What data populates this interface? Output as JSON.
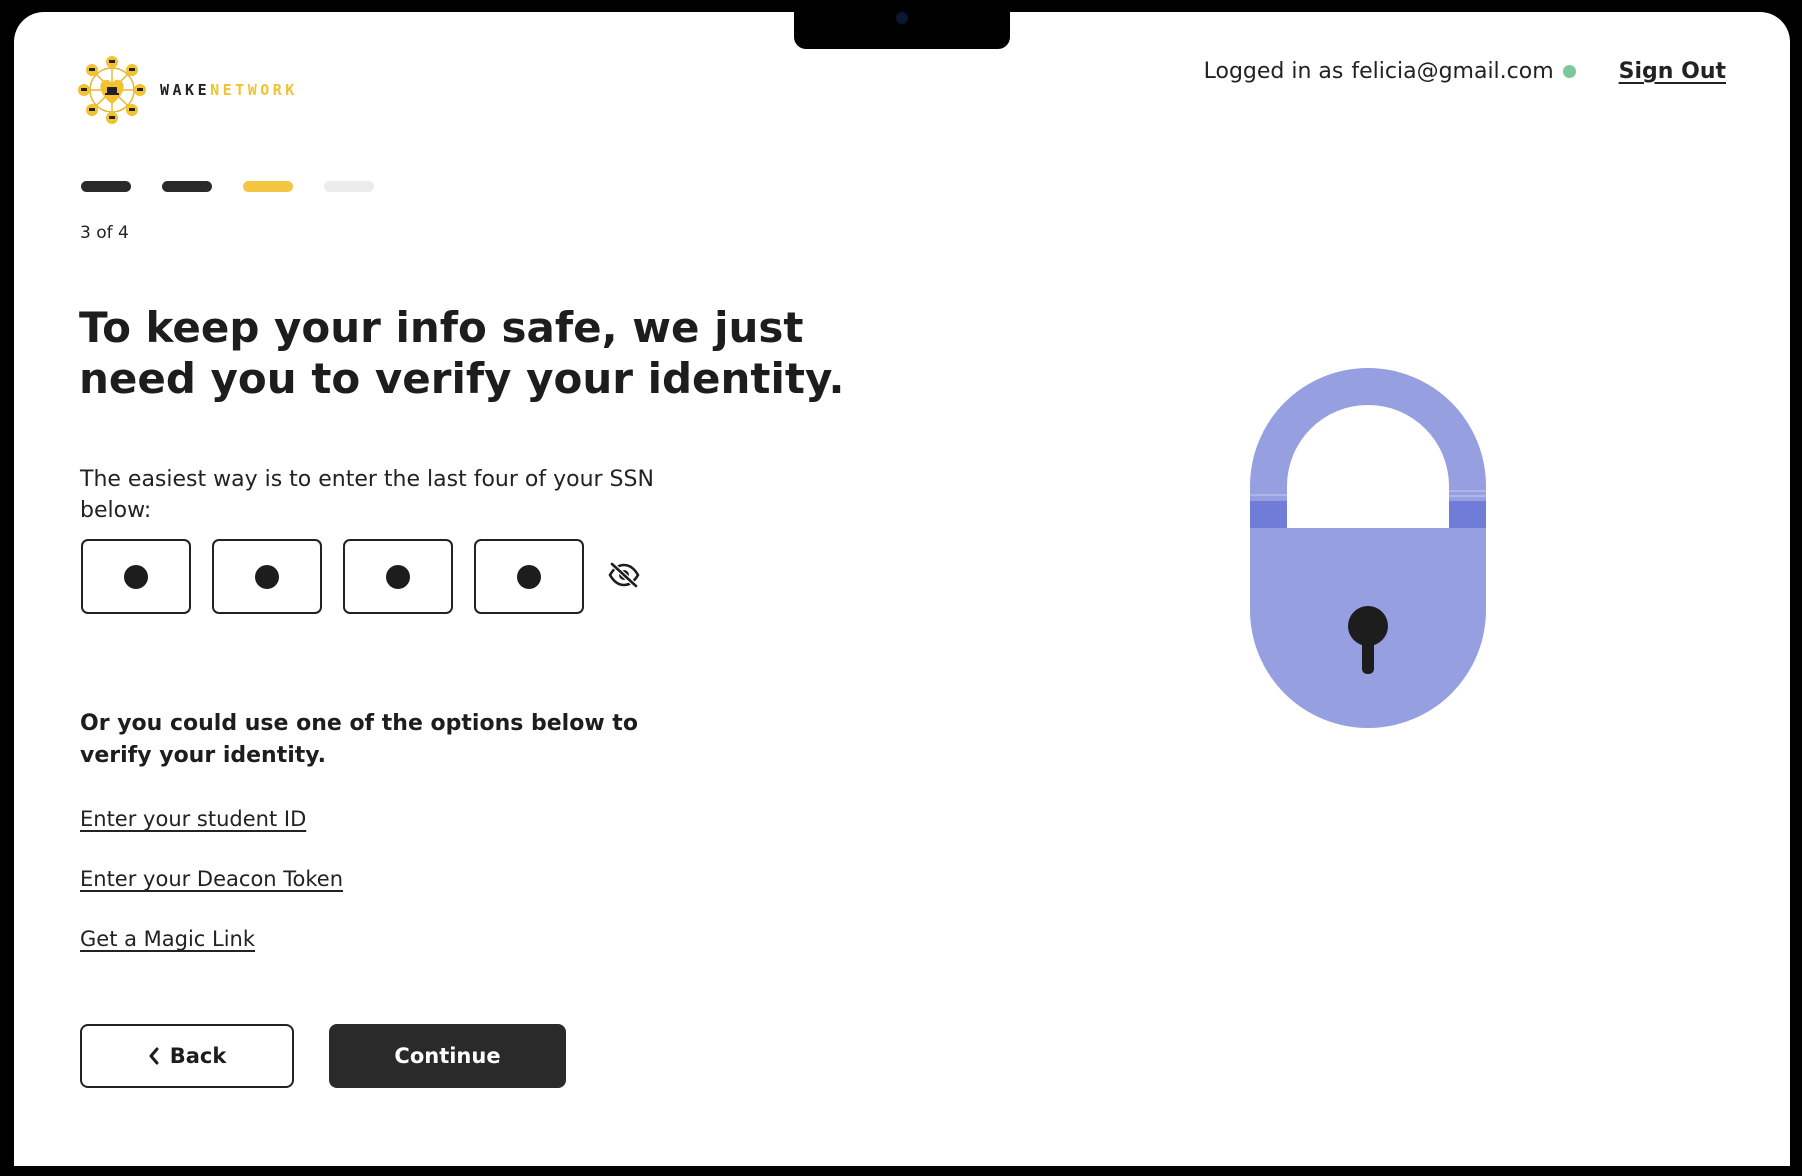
{
  "brand": {
    "logo_icon": "network-hub-icon",
    "name_part1": "WAKE",
    "name_part2": "NETWORK",
    "accent_color": "#f4c542"
  },
  "header": {
    "logged_in_prefix": "Logged in as",
    "user_email": "felicia@gmail.com",
    "status": "online",
    "status_color": "#7ec79c",
    "sign_out_label": "Sign Out"
  },
  "progress": {
    "current_step": 3,
    "total_steps": 4,
    "label": "3 of 4"
  },
  "main": {
    "title": "To keep your info safe, we just need you to verify your identity.",
    "intro": "The easiest way is to enter the last four of your SSN below:",
    "ssn_digits": [
      "•",
      "•",
      "•",
      "•"
    ],
    "visibility_icon": "eye-off-icon",
    "alt_heading": "Or you could use one of the options below to verify your identity.",
    "alt_options": [
      "Enter your student ID",
      "Enter your Deacon Token",
      "Get a Magic Link"
    ]
  },
  "actions": {
    "back_label": "Back",
    "back_icon": "chevron-left-icon",
    "continue_label": "Continue"
  },
  "illustration": {
    "icon": "padlock-icon",
    "color": "#96a0e0"
  }
}
